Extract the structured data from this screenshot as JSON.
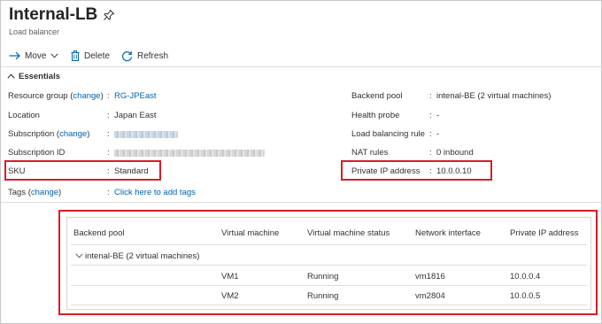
{
  "resource": {
    "title": "Internal-LB",
    "subtitle": "Load balancer"
  },
  "toolbar": {
    "move_label": "Move",
    "delete_label": "Delete",
    "refresh_label": "Refresh"
  },
  "essentials": {
    "heading": "Essentials",
    "left": {
      "resource_group_label": "Resource group (",
      "resource_group_change": "change",
      "resource_group_label_end": ")",
      "resource_group_value": "RG-JPEast",
      "location_label": "Location",
      "location_value": "Japan East",
      "subscription_label": "Subscription (",
      "subscription_change": "change",
      "subscription_label_end": ")",
      "subscription_id_label": "Subscription ID",
      "sku_label": "SKU",
      "sku_value": "Standard",
      "tags_label": "Tags (",
      "tags_change": "change",
      "tags_label_end": ")",
      "tags_value": "Click here to add tags"
    },
    "right": {
      "backend_pool_label": "Backend pool",
      "backend_pool_value": "intenal-BE (2 virtual machines)",
      "health_probe_label": "Health probe",
      "health_probe_value": "-",
      "lb_rule_label": "Load balancing rule",
      "lb_rule_value": "-",
      "nat_rules_label": "NAT rules",
      "nat_rules_value": "0 inbound",
      "private_ip_label": "Private IP address",
      "private_ip_value": "10.0.0.10"
    },
    "separator": ":"
  },
  "backend_table": {
    "headers": [
      "Backend pool",
      "Virtual machine",
      "Virtual machine status",
      "Network interface",
      "Private IP address"
    ],
    "group_label": "intenal-BE (2 virtual machines)",
    "rows": [
      {
        "vm": "VM1",
        "status": "Running",
        "nic": "vm1816",
        "ip": "10.0.0.4"
      },
      {
        "vm": "VM2",
        "status": "Running",
        "nic": "vm2804",
        "ip": "10.0.0.5"
      }
    ]
  },
  "colors": {
    "link": "#0062ad",
    "highlight_box": "#d51f26",
    "text": "#323130"
  }
}
